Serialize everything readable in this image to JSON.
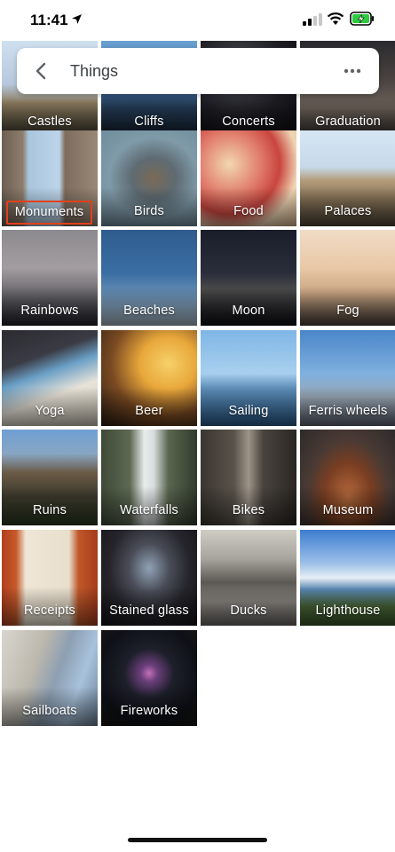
{
  "status_bar": {
    "time": "11:41"
  },
  "header": {
    "title": "Things"
  },
  "categories": [
    "Castles",
    "Cliffs",
    "Concerts",
    "Graduation",
    "Monuments",
    "Birds",
    "Food",
    "Palaces",
    "Rainbows",
    "Beaches",
    "Moon",
    "Fog",
    "Yoga",
    "Beer",
    "Sailing",
    "Ferris wheels",
    "Ruins",
    "Waterfalls",
    "Bikes",
    "Museum",
    "Receipts",
    "Stained glass",
    "Ducks",
    "Lighthouse",
    "Sailboats",
    "Fireworks"
  ],
  "highlighted_category": "Monuments",
  "colors": {
    "highlight_border": "#e2401c"
  }
}
